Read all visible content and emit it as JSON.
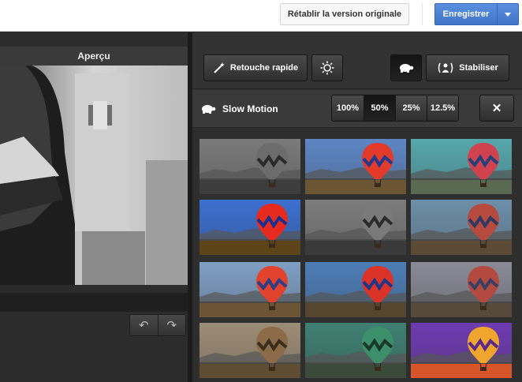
{
  "header": {
    "restore_label": "Rétablir la version originale",
    "save_label": "Enregistrer"
  },
  "preview": {
    "title": "Aperçu"
  },
  "toolbar": {
    "quick_fix_label": "Retouche rapide",
    "stabilize_label": "Stabiliser"
  },
  "slow_motion": {
    "title": "Slow Motion",
    "speeds": [
      "100%",
      "50%",
      "25%",
      "12.5%"
    ],
    "selected": "50%",
    "close_label": "✕"
  },
  "filters": [
    {
      "name": "grayscale-red-balloon",
      "sky": "#7a7a7a",
      "ground": "#3d3d3d",
      "balloon": "#6c6c6c",
      "stripe": "#2a2a2a"
    },
    {
      "name": "natural",
      "sky": "#5d86c4",
      "ground": "#6b5533",
      "balloon": "#e23a2b",
      "stripe": "#233a8c"
    },
    {
      "name": "teal-cross",
      "sky": "#56a7ac",
      "ground": "#5a6a52",
      "balloon": "#d1424f",
      "stripe": "#23407a"
    },
    {
      "name": "saturated-blue",
      "sky": "#3b6fd0",
      "ground": "#5c4418",
      "balloon": "#e62b1e",
      "stripe": "#17308f"
    },
    {
      "name": "vignette-bw",
      "sky": "#7c7c7c",
      "ground": "#3a3a3a",
      "balloon": "#7a7a7a",
      "stripe": "#2b2b2b"
    },
    {
      "name": "faded",
      "sky": "#6d8fa9",
      "ground": "#5b4b36",
      "balloon": "#b64a3e",
      "stripe": "#2c3962"
    },
    {
      "name": "warm",
      "sky": "#7f9fc4",
      "ground": "#6c5435",
      "balloon": "#e2432d",
      "stripe": "#2b3e86"
    },
    {
      "name": "cool",
      "sky": "#4d7db6",
      "ground": "#54462f",
      "balloon": "#db3328",
      "stripe": "#1f3585"
    },
    {
      "name": "muted",
      "sky": "#8a8a97",
      "ground": "#574a3c",
      "balloon": "#b34a40",
      "stripe": "#3a3f62"
    },
    {
      "name": "sepia",
      "sky": "#9d8d76",
      "ground": "#5e4c33",
      "balloon": "#8c6b49",
      "stripe": "#3a2e1e"
    },
    {
      "name": "green-cross",
      "sky": "#3f7f72",
      "ground": "#3b4a3a",
      "balloon": "#3c8f6a",
      "stripe": "#193828"
    },
    {
      "name": "purple-sunset",
      "sky": "#6d3bb0",
      "ground": "#d8552a",
      "balloon": "#f0a52e",
      "stripe": "#5a2a8a"
    }
  ]
}
